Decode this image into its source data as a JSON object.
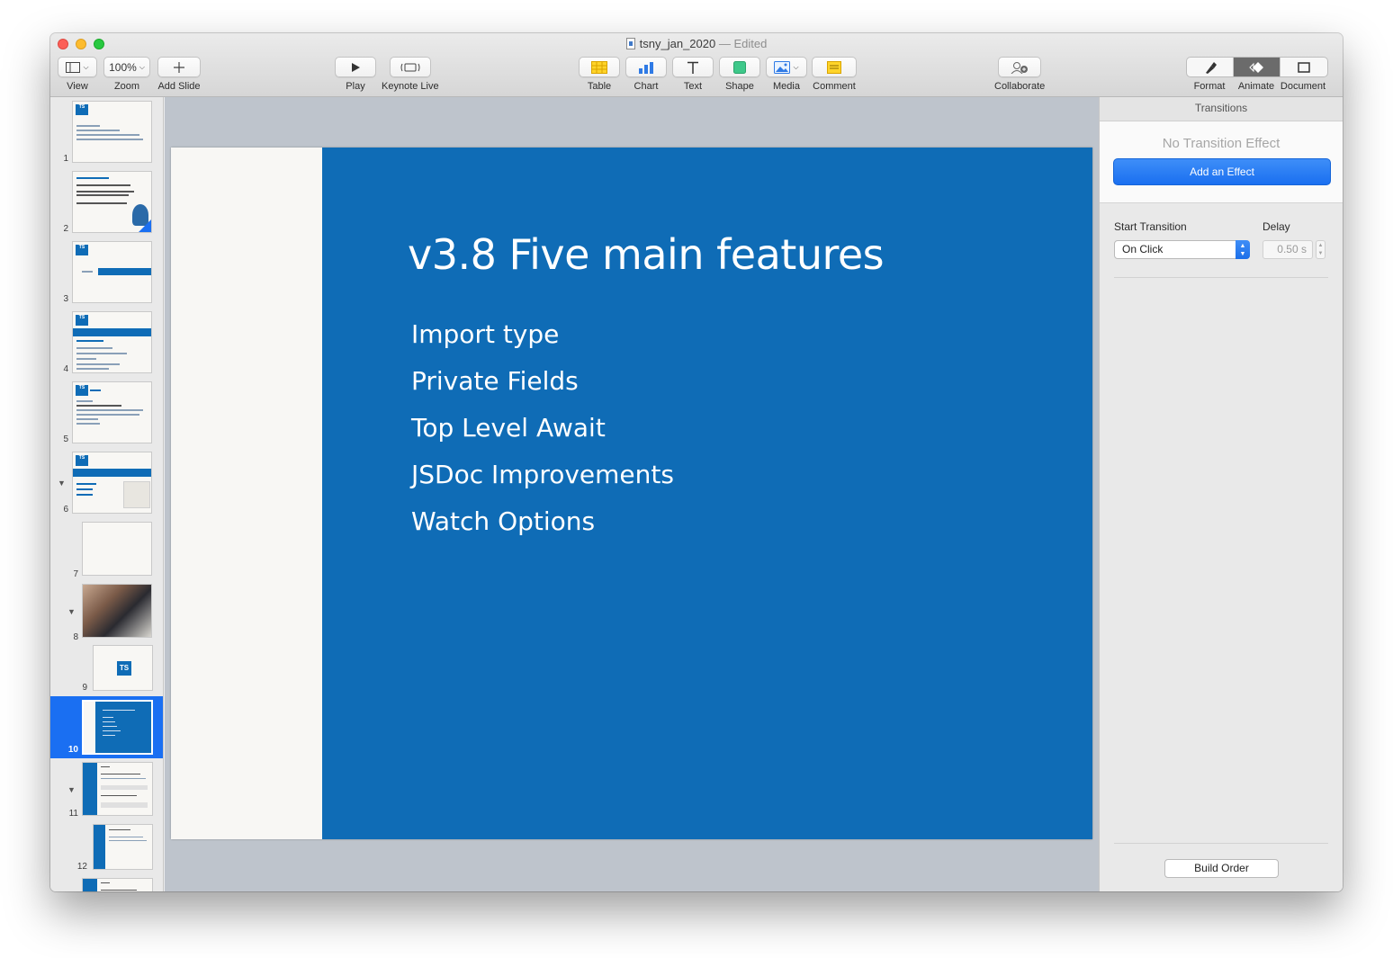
{
  "window": {
    "title": "tsny_jan_2020",
    "edited": "— Edited"
  },
  "toolbar": {
    "view": "View",
    "zoom_value": "100%",
    "zoom": "Zoom",
    "add_slide": "Add Slide",
    "play": "Play",
    "keynote_live": "Keynote Live",
    "table": "Table",
    "chart": "Chart",
    "text": "Text",
    "shape": "Shape",
    "media": "Media",
    "comment": "Comment",
    "collaborate": "Collaborate",
    "format": "Format",
    "animate": "Animate",
    "document": "Document"
  },
  "navigator": {
    "slides": [
      {
        "num": "1"
      },
      {
        "num": "2"
      },
      {
        "num": "3"
      },
      {
        "num": "4"
      },
      {
        "num": "5"
      },
      {
        "num": "6"
      },
      {
        "num": "7"
      },
      {
        "num": "8"
      },
      {
        "num": "9"
      },
      {
        "num": "10"
      },
      {
        "num": "11"
      },
      {
        "num": "12"
      }
    ],
    "selected": "10"
  },
  "slide": {
    "title": "v3.8 Five main features",
    "bullets": [
      "Import type",
      "Private Fields",
      "Top Level Await",
      "JSDoc Improvements",
      "Watch Options"
    ],
    "accent": "#0f6cb6"
  },
  "inspector": {
    "header": "Transitions",
    "no_effect": "No Transition Effect",
    "add_effect": "Add an Effect",
    "start_transition_label": "Start Transition",
    "start_transition_value": "On Click",
    "delay_label": "Delay",
    "delay_value": "0.50 s",
    "build_order": "Build Order"
  }
}
